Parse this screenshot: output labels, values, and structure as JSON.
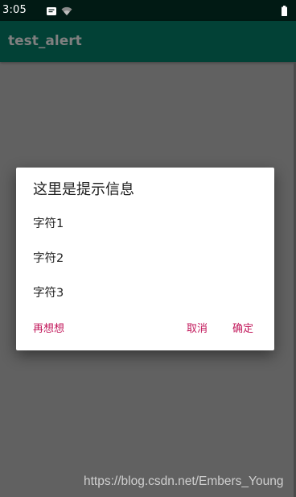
{
  "status_bar": {
    "time": "3:05",
    "icons": [
      "notification-icon",
      "wifi-icon",
      "battery-icon"
    ]
  },
  "app_bar": {
    "title": "test_alert"
  },
  "dialog": {
    "title": "这里是提示信息",
    "items": [
      "字符1",
      "字符2",
      "字符3"
    ],
    "neutral_button": "再想想",
    "negative_button": "取消",
    "positive_button": "确定"
  },
  "watermark": "https://blog.csdn.net/Embers_Young",
  "colors": {
    "status_bar": "#011a14",
    "app_bar": "#024136",
    "scrim_background": "#616161",
    "dialog_button": "#c2185b"
  }
}
